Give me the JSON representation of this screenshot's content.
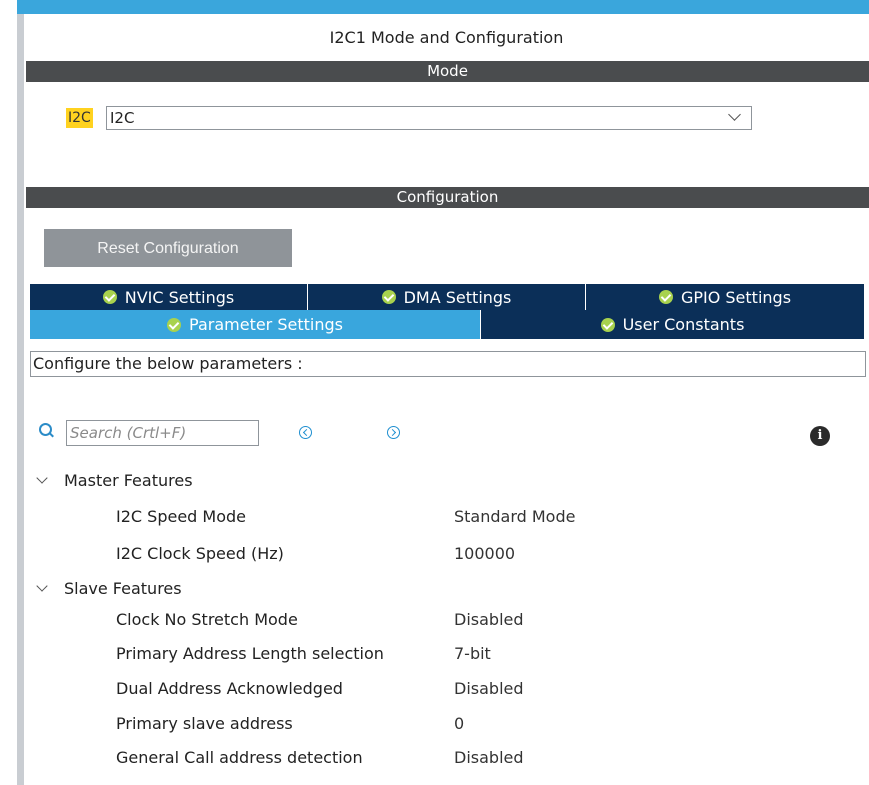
{
  "title": "I2C1 Mode and Configuration",
  "mode": {
    "section_label": "Mode",
    "badge": "I2C",
    "select_value": "I2C"
  },
  "configuration": {
    "section_label": "Configuration",
    "reset_label": "Reset Configuration"
  },
  "tabs_row1": [
    {
      "label": "NVIC Settings"
    },
    {
      "label": "DMA Settings"
    },
    {
      "label": "GPIO Settings"
    }
  ],
  "tabs_row2": [
    {
      "label": "Parameter Settings",
      "active": true
    },
    {
      "label": "User Constants",
      "active": false
    }
  ],
  "description": "Configure the below parameters :",
  "search": {
    "placeholder": "Search (Crtl+F)"
  },
  "groups": [
    {
      "name": "Master Features",
      "params": [
        {
          "name": "I2C Speed Mode",
          "value": "Standard Mode"
        },
        {
          "name": "I2C Clock Speed (Hz)",
          "value": "100000"
        }
      ]
    },
    {
      "name": "Slave Features",
      "params": [
        {
          "name": "Clock No Stretch Mode",
          "value": "Disabled"
        },
        {
          "name": "Primary Address Length selection",
          "value": "7-bit"
        },
        {
          "name": "Dual Address Acknowledged",
          "value": "Disabled"
        },
        {
          "name": "Primary slave address",
          "value": "0"
        },
        {
          "name": "General Call address detection",
          "value": "Disabled"
        }
      ]
    }
  ],
  "colors": {
    "accent": "#3aa6dc",
    "tab_dark": "#0b2f58",
    "tab_active": "#39a6dd",
    "section_bar": "#4a4c4e",
    "badge": "#ffd21f",
    "check": "#a8d24e"
  }
}
